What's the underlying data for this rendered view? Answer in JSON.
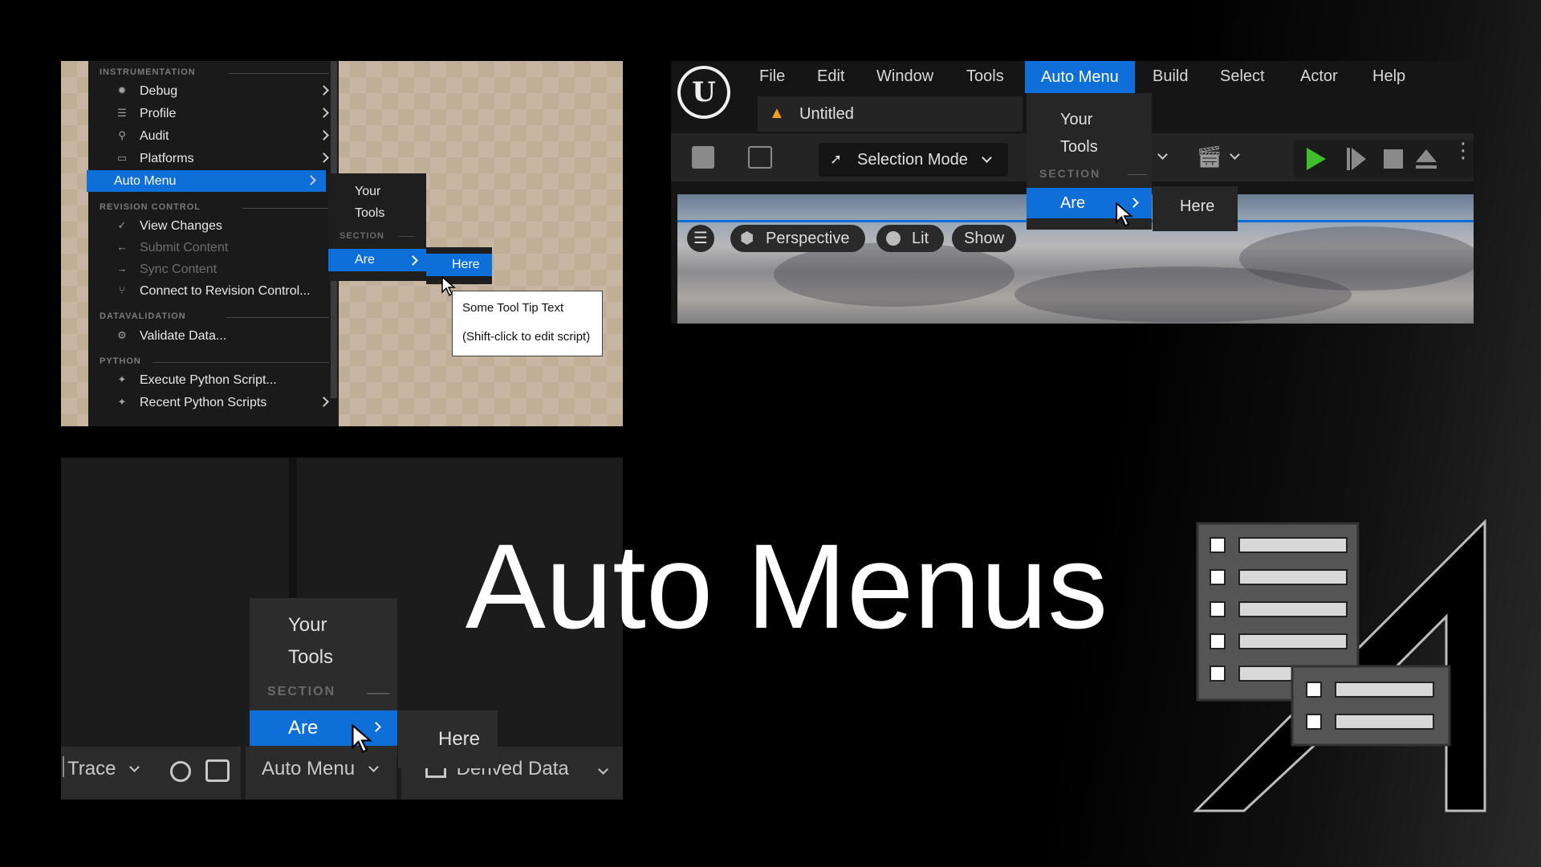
{
  "title": "Auto Menus",
  "panel_tools_menu": {
    "sections": {
      "instrumentation": "INSTRUMENTATION",
      "revision_control": "REVISION CONTROL",
      "datavalidation": "DATAVALIDATION",
      "python": "PYTHON",
      "section": "SECTION"
    },
    "items": {
      "debug": "Debug",
      "profile": "Profile",
      "audit": "Audit",
      "platforms": "Platforms",
      "auto_menu": "Auto Menu",
      "view_changes": "View Changes",
      "submit_content": "Submit Content",
      "sync_content": "Sync Content",
      "connect_rc": "Connect to Revision Control...",
      "validate_data": "Validate Data...",
      "execute_python": "Execute Python Script...",
      "recent_python": "Recent Python Scripts"
    },
    "submenu": {
      "your": "Your",
      "tools": "Tools",
      "are": "Are",
      "here": "Here"
    },
    "tooltip": {
      "line1": "Some Tool Tip Text",
      "line2": "(Shift-click to edit script)"
    }
  },
  "panel_menubar": {
    "menus": [
      "File",
      "Edit",
      "Window",
      "Tools",
      "Auto Menu",
      "Build",
      "Select",
      "Actor",
      "Help"
    ],
    "tab_title": "Untitled",
    "selection_mode": "Selection Mode",
    "viewport": {
      "perspective": "Perspective",
      "lit": "Lit",
      "show": "Show"
    },
    "dropdown": {
      "your": "Your",
      "tools": "Tools",
      "section": "SECTION",
      "are": "Are",
      "here": "Here"
    }
  },
  "panel_statusbar": {
    "trace": "Trace",
    "auto_menu": "Auto Menu",
    "derived_data": "Derived Data",
    "dropdown": {
      "your": "Your",
      "tools": "Tools",
      "section": "SECTION",
      "are": "Are",
      "here": "Here"
    }
  },
  "colors": {
    "accent": "#0e6fd8",
    "menu_bg": "#1a1a1a",
    "play_green": "#3fbf2a"
  }
}
